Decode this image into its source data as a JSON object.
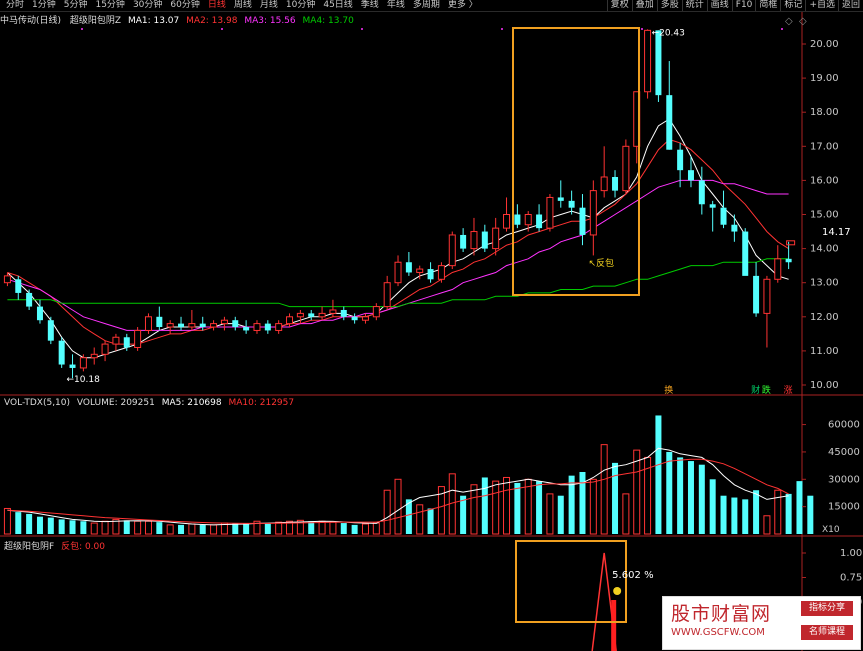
{
  "toolbar": {
    "periods": [
      "分时",
      "1分钟",
      "5分钟",
      "15分钟",
      "30分钟",
      "60分钟",
      "日线",
      "周线",
      "月线",
      "10分钟",
      "45日线",
      "季线",
      "年线",
      "多周期",
      "更多 〉"
    ],
    "active_period_index": 6,
    "tools": [
      "复权",
      "叠加",
      "多股",
      "统计",
      "画线",
      "F10",
      "简框",
      "标记",
      "+自选",
      "返回"
    ]
  },
  "price_legend": {
    "stock": "中马传动(日线)",
    "indicator": "超级阳包阴Z",
    "ma1": "MA1: 13.07",
    "ma2": "MA2: 13.98",
    "ma3": "MA3: 15.56",
    "ma4": "MA4: 13.70"
  },
  "vol_legend": {
    "name": "VOL-TDX(5,10)",
    "volume": "VOLUME: 209251",
    "ma5": "MA5: 210698",
    "ma10": "MA10: 212957"
  },
  "ind_legend": {
    "name": "超级阳包阴F",
    "value": "反包: 0.00"
  },
  "annotations": {
    "high": "20.43",
    "low": "10.18",
    "fanbao": "反包",
    "pct_value": "5.602",
    "pct_unit": "%",
    "current_price": "14.17",
    "vol_unit": "X10"
  },
  "colors": {
    "up": "#ff3333",
    "down": "#54ffff",
    "ma1": "#ffffff",
    "ma2": "#ff3333",
    "ma3": "#ff33ff",
    "ma4": "#00cc00",
    "box": "#f0a020"
  },
  "chart_data": [
    {
      "type": "candlestick",
      "ylim": [
        10.0,
        20.5
      ],
      "yticks": [
        "20.00",
        "19.00",
        "18.00",
        "17.00",
        "16.00",
        "15.00",
        "14.00",
        "13.00",
        "12.00",
        "11.00",
        "10.00"
      ],
      "candles": [
        [
          13.0,
          13.3,
          12.9,
          13.2
        ],
        [
          13.1,
          13.2,
          12.5,
          12.7
        ],
        [
          12.7,
          12.8,
          12.2,
          12.3
        ],
        [
          12.3,
          12.5,
          11.8,
          11.9
        ],
        [
          11.9,
          12.0,
          11.2,
          11.3
        ],
        [
          11.3,
          11.4,
          10.5,
          10.6
        ],
        [
          10.6,
          10.9,
          10.2,
          10.5
        ],
        [
          10.5,
          10.9,
          10.4,
          10.8
        ],
        [
          10.8,
          11.1,
          10.6,
          10.9
        ],
        [
          10.9,
          11.3,
          10.7,
          11.2
        ],
        [
          11.2,
          11.5,
          11.0,
          11.4
        ],
        [
          11.4,
          11.5,
          11.0,
          11.1
        ],
        [
          11.1,
          11.7,
          11.0,
          11.6
        ],
        [
          11.6,
          12.1,
          11.5,
          12.0
        ],
        [
          12.0,
          12.3,
          11.6,
          11.7
        ],
        [
          11.7,
          11.9,
          11.5,
          11.8
        ],
        [
          11.8,
          12.0,
          11.6,
          11.7
        ],
        [
          11.7,
          12.2,
          11.6,
          11.8
        ],
        [
          11.8,
          12.0,
          11.6,
          11.7
        ],
        [
          11.7,
          11.9,
          11.6,
          11.8
        ],
        [
          11.8,
          12.0,
          11.6,
          11.9
        ],
        [
          11.9,
          12.0,
          11.6,
          11.7
        ],
        [
          11.7,
          11.9,
          11.5,
          11.6
        ],
        [
          11.6,
          11.9,
          11.5,
          11.8
        ],
        [
          11.8,
          11.9,
          11.5,
          11.6
        ],
        [
          11.6,
          11.9,
          11.5,
          11.8
        ],
        [
          11.8,
          12.1,
          11.7,
          12.0
        ],
        [
          12.0,
          12.2,
          11.8,
          12.1
        ],
        [
          12.1,
          12.2,
          11.9,
          12.0
        ],
        [
          12.0,
          12.3,
          11.9,
          12.1
        ],
        [
          12.1,
          12.5,
          12.0,
          12.2
        ],
        [
          12.2,
          12.3,
          11.9,
          12.0
        ],
        [
          12.0,
          12.1,
          11.8,
          11.9
        ],
        [
          11.9,
          12.1,
          11.8,
          12.0
        ],
        [
          12.0,
          12.4,
          11.9,
          12.3
        ],
        [
          12.3,
          13.2,
          12.2,
          13.0
        ],
        [
          13.0,
          13.8,
          12.9,
          13.6
        ],
        [
          13.6,
          13.9,
          13.2,
          13.3
        ],
        [
          13.3,
          13.5,
          13.1,
          13.4
        ],
        [
          13.4,
          13.6,
          13.0,
          13.1
        ],
        [
          13.1,
          13.6,
          13.0,
          13.5
        ],
        [
          13.5,
          14.5,
          13.4,
          14.4
        ],
        [
          14.4,
          14.6,
          13.9,
          14.0
        ],
        [
          14.0,
          14.9,
          13.8,
          14.5
        ],
        [
          14.5,
          14.7,
          13.9,
          14.0
        ],
        [
          14.0,
          14.9,
          13.8,
          14.6
        ],
        [
          14.6,
          15.5,
          14.5,
          15.0
        ],
        [
          15.0,
          15.3,
          14.6,
          14.7
        ],
        [
          14.7,
          15.1,
          14.5,
          15.0
        ],
        [
          15.0,
          15.3,
          14.5,
          14.6
        ],
        [
          14.6,
          15.6,
          14.5,
          15.5
        ],
        [
          15.5,
          16.0,
          15.2,
          15.4
        ],
        [
          15.4,
          15.7,
          15.0,
          15.2
        ],
        [
          15.2,
          15.6,
          14.1,
          14.4
        ],
        [
          14.4,
          16.0,
          13.8,
          15.7
        ],
        [
          15.7,
          17.0,
          15.5,
          16.1
        ],
        [
          16.1,
          16.3,
          15.5,
          15.7
        ],
        [
          15.7,
          17.2,
          15.6,
          17.0
        ],
        [
          17.0,
          18.3,
          16.5,
          18.6
        ],
        [
          18.6,
          20.43,
          18.4,
          20.4
        ],
        [
          20.4,
          20.4,
          18.3,
          18.5
        ],
        [
          18.5,
          19.5,
          16.9,
          16.9
        ],
        [
          16.9,
          17.1,
          15.8,
          16.3
        ],
        [
          16.3,
          16.7,
          15.8,
          16.0
        ],
        [
          16.0,
          16.4,
          15.0,
          15.3
        ],
        [
          15.3,
          15.4,
          14.5,
          15.2
        ],
        [
          15.2,
          15.7,
          14.6,
          14.7
        ],
        [
          14.7,
          15.0,
          14.2,
          14.5
        ],
        [
          14.5,
          14.6,
          13.5,
          13.2
        ],
        [
          13.2,
          13.6,
          12.0,
          12.1
        ],
        [
          12.1,
          13.2,
          11.1,
          13.1
        ],
        [
          13.1,
          14.1,
          13.0,
          13.7
        ],
        [
          13.7,
          14.2,
          13.4,
          13.6
        ]
      ],
      "ma1": [
        13.3,
        13.0,
        12.7,
        12.3,
        11.9,
        11.4,
        11.0,
        10.8,
        10.8,
        10.9,
        11.0,
        11.1,
        11.2,
        11.4,
        11.6,
        11.7,
        11.7,
        11.7,
        11.7,
        11.7,
        11.8,
        11.8,
        11.7,
        11.7,
        11.7,
        11.7,
        11.8,
        11.9,
        12.0,
        12.0,
        12.1,
        12.1,
        12.0,
        12.0,
        12.1,
        12.4,
        12.7,
        13.0,
        13.2,
        13.3,
        13.4,
        13.6,
        13.7,
        13.9,
        14.1,
        14.2,
        14.4,
        14.5,
        14.6,
        14.7,
        14.9,
        15.0,
        15.1,
        15.0,
        14.9,
        15.2,
        15.4,
        15.6,
        16.1,
        17.0,
        17.6,
        17.8,
        17.3,
        16.7,
        16.0,
        15.6,
        15.2,
        14.9,
        14.4,
        13.8,
        13.5,
        13.2,
        13.1
      ],
      "ma2": [
        13.3,
        13.2,
        13.0,
        12.8,
        12.6,
        12.3,
        12.0,
        11.7,
        11.5,
        11.3,
        11.2,
        11.2,
        11.2,
        11.3,
        11.4,
        11.5,
        11.5,
        11.6,
        11.6,
        11.7,
        11.7,
        11.7,
        11.7,
        11.7,
        11.7,
        11.7,
        11.8,
        11.8,
        11.9,
        11.9,
        12.0,
        12.0,
        12.0,
        12.0,
        12.1,
        12.2,
        12.4,
        12.6,
        12.8,
        12.9,
        13.1,
        13.3,
        13.4,
        13.6,
        13.7,
        13.9,
        14.1,
        14.2,
        14.4,
        14.5,
        14.6,
        14.7,
        14.8,
        14.8,
        14.9,
        15.1,
        15.3,
        15.6,
        15.9,
        16.4,
        16.9,
        17.2,
        17.1,
        16.9,
        16.6,
        16.3,
        15.9,
        15.6,
        15.3,
        14.9,
        14.5,
        14.2,
        14.0
      ],
      "ma3": [
        13.1,
        13.0,
        12.9,
        12.8,
        12.6,
        12.4,
        12.2,
        12.0,
        11.9,
        11.8,
        11.7,
        11.6,
        11.6,
        11.6,
        11.6,
        11.6,
        11.6,
        11.6,
        11.7,
        11.7,
        11.7,
        11.7,
        11.7,
        11.7,
        11.7,
        11.7,
        11.7,
        11.8,
        11.8,
        11.9,
        11.9,
        12.0,
        12.0,
        12.1,
        12.1,
        12.2,
        12.3,
        12.4,
        12.5,
        12.6,
        12.7,
        12.8,
        13.0,
        13.1,
        13.2,
        13.3,
        13.5,
        13.6,
        13.7,
        13.9,
        14.0,
        14.2,
        14.3,
        14.4,
        14.6,
        14.8,
        15.0,
        15.2,
        15.4,
        15.6,
        15.8,
        15.9,
        16.0,
        16.0,
        16.0,
        16.0,
        15.9,
        15.9,
        15.8,
        15.7,
        15.6,
        15.6,
        15.6
      ],
      "ma4": [
        12.5,
        12.5,
        12.5,
        12.5,
        12.5,
        12.4,
        12.4,
        12.4,
        12.4,
        12.4,
        12.4,
        12.4,
        12.4,
        12.4,
        12.4,
        12.4,
        12.4,
        12.4,
        12.4,
        12.4,
        12.4,
        12.4,
        12.4,
        12.4,
        12.4,
        12.4,
        12.3,
        12.3,
        12.3,
        12.3,
        12.3,
        12.3,
        12.3,
        12.3,
        12.3,
        12.3,
        12.3,
        12.4,
        12.4,
        12.4,
        12.4,
        12.5,
        12.5,
        12.5,
        12.5,
        12.6,
        12.6,
        12.6,
        12.7,
        12.7,
        12.7,
        12.8,
        12.8,
        12.8,
        12.9,
        12.9,
        12.9,
        13.0,
        13.1,
        13.1,
        13.2,
        13.3,
        13.4,
        13.5,
        13.5,
        13.5,
        13.6,
        13.6,
        13.6,
        13.6,
        13.7,
        13.7,
        13.7
      ],
      "markers": [
        {
          "label": "换",
          "index": 61
        },
        {
          "label": "财",
          "index": 69
        },
        {
          "label": "跌",
          "index": 70
        },
        {
          "label": "涨",
          "index": 72
        }
      ]
    },
    {
      "type": "bar",
      "ylabel": "X10",
      "ylim": [
        0,
        68000
      ],
      "yticks": [
        "60000",
        "45000",
        "30000",
        "15000"
      ],
      "values": [
        14000,
        12000,
        11000,
        9500,
        9000,
        8000,
        7500,
        7000,
        6000,
        7000,
        8000,
        7500,
        7000,
        7000,
        6500,
        5000,
        5000,
        5500,
        5000,
        5000,
        6000,
        6000,
        6000,
        7000,
        6000,
        6500,
        7000,
        7500,
        7000,
        7000,
        6500,
        6000,
        5000,
        5500,
        6000,
        24000,
        30000,
        19000,
        16000,
        14000,
        26000,
        33000,
        21000,
        27000,
        31000,
        29000,
        31000,
        28000,
        30000,
        29000,
        22000,
        21000,
        32000,
        34000,
        30000,
        49000,
        39000,
        22000,
        46000,
        42000,
        65000,
        45000,
        42000,
        40000,
        38000,
        30000,
        21000,
        20000,
        19000,
        24000,
        10000,
        24000,
        22000,
        29000,
        21000
      ],
      "up": [
        true,
        false,
        false,
        false,
        false,
        false,
        false,
        false,
        true,
        true,
        true,
        false,
        true,
        true,
        false,
        true,
        false,
        true,
        false,
        true,
        true,
        false,
        false,
        true,
        false,
        true,
        true,
        true,
        false,
        true,
        true,
        false,
        false,
        true,
        true,
        true,
        true,
        false,
        true,
        false,
        true,
        true,
        false,
        true,
        false,
        true,
        true,
        false,
        true,
        false,
        true,
        false,
        false,
        false,
        true,
        true,
        false,
        true,
        true,
        true,
        false,
        false,
        false,
        false,
        false,
        false,
        false,
        false,
        false,
        false,
        true,
        true,
        false
      ],
      "ma5": [
        13000,
        12500,
        12000,
        11000,
        10000,
        9000,
        8000,
        7500,
        7000,
        6800,
        7000,
        7200,
        7300,
        7200,
        7000,
        6500,
        6000,
        5500,
        5200,
        5000,
        5200,
        5400,
        5500,
        5800,
        6000,
        6200,
        6400,
        6600,
        6800,
        7000,
        6900,
        6600,
        6200,
        6000,
        5800,
        9000,
        13000,
        17000,
        20000,
        21000,
        22000,
        24000,
        23000,
        24000,
        25000,
        27000,
        28000,
        29000,
        30000,
        29000,
        28000,
        27000,
        27000,
        28000,
        31000,
        35000,
        37000,
        38000,
        40000,
        42000,
        47000,
        46000,
        44000,
        43000,
        42000,
        38000,
        32000,
        27000,
        24000,
        22000,
        19000,
        20000,
        21000
      ],
      "ma10": [
        13000,
        12800,
        12500,
        12000,
        11500,
        11000,
        10500,
        10000,
        9500,
        9000,
        8700,
        8400,
        8000,
        7700,
        7400,
        7100,
        6800,
        6500,
        6300,
        6100,
        6000,
        5900,
        5800,
        5800,
        5800,
        5900,
        6000,
        6100,
        6200,
        6300,
        6400,
        6500,
        6500,
        6500,
        6500,
        7500,
        9000,
        10500,
        12000,
        13500,
        15000,
        17000,
        18500,
        20000,
        21000,
        22500,
        24000,
        25000,
        26000,
        27000,
        27500,
        27500,
        28000,
        28000,
        28500,
        30000,
        32000,
        33000,
        34000,
        36000,
        38000,
        40000,
        40500,
        41000,
        41000,
        40000,
        38500,
        36000,
        33000,
        30000,
        27000,
        25000,
        22000
      ]
    },
    {
      "type": "line",
      "name": "超级阳包阴F",
      "ylim": [
        0,
        1.1
      ],
      "yticks": [
        "1.00",
        "0.75",
        "0.50"
      ],
      "spike": {
        "index": 55,
        "value": 1.0
      },
      "annotation_value": 5.602
    }
  ]
}
